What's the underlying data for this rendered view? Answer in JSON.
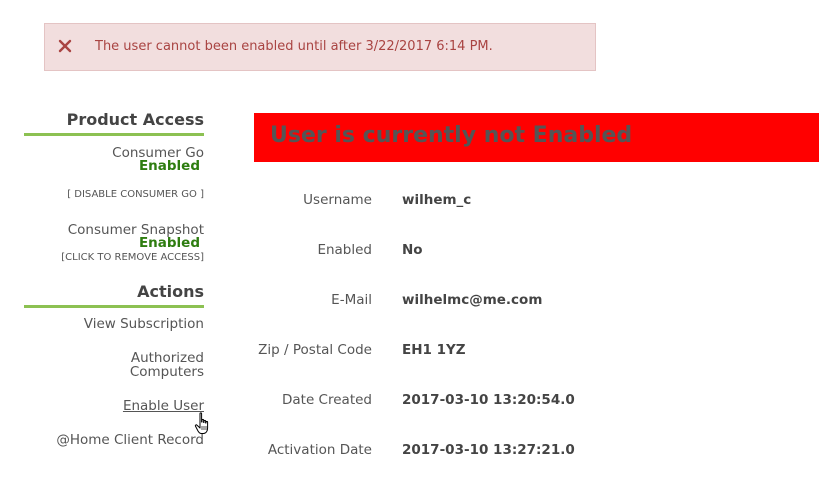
{
  "alert": {
    "icon": "close-x-icon",
    "color": "#a94442",
    "message": "The user cannot been enabled until after 3/22/2017 6:14 PM."
  },
  "sidebar": {
    "product_access": {
      "heading": "Product Access",
      "consumer_go_label": "Consumer Go",
      "consumer_go_status": "Enabled",
      "disable_consumer_go": "[ DISABLE CONSUMER GO ]",
      "consumer_snapshot_label": "Consumer Snapshot",
      "consumer_snapshot_status": "Enabled",
      "remove_access": "[CLICK TO REMOVE ACCESS]"
    },
    "actions": {
      "heading": "Actions",
      "view_subscription": "View Subscription",
      "authorized_line1": "Authorized",
      "authorized_line2": "Computers",
      "enable_user": "Enable User",
      "home_client_record": "@Home Client Record"
    }
  },
  "banner": {
    "text": "User is currently not Enabled",
    "background": "#ff0000"
  },
  "details": [
    {
      "label": "Username",
      "value": "wilhem_c"
    },
    {
      "label": "Enabled",
      "value": "No"
    },
    {
      "label": "E-Mail",
      "value": "wilhelmc@me.com"
    },
    {
      "label": "Zip / Postal Code",
      "value": "EH1 1YZ"
    },
    {
      "label": "Date Created",
      "value": "2017-03-10 13:20:54.0"
    },
    {
      "label": "Activation Date",
      "value": "2017-03-10 13:27:21.0"
    }
  ],
  "colors": {
    "accent_underline": "#8cc152",
    "enabled_status": "#2e7d10"
  },
  "cursor": {
    "icon": "hand-pointer-cursor-icon"
  }
}
